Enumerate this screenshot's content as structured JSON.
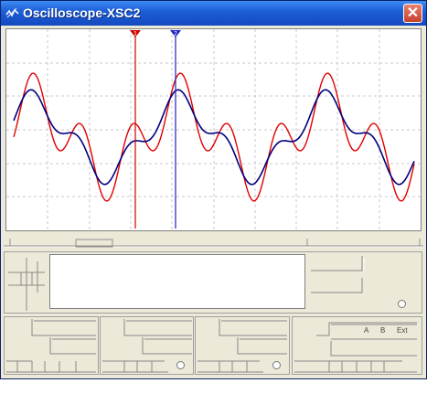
{
  "window": {
    "title": "Oscilloscope-XSC2",
    "close_glyph": "✕",
    "icon": "oscilloscope-icon"
  },
  "scope": {
    "cursor1_label": "1",
    "cursor2_label": "2",
    "colors": {
      "channel_a": "#e00000",
      "channel_b": "#000080",
      "cursor1": "#d00000",
      "cursor2": "#2020c0",
      "grid": "#c8c8c8"
    }
  },
  "trigger": {
    "labels": [
      "A",
      "B",
      "Ext"
    ]
  }
}
